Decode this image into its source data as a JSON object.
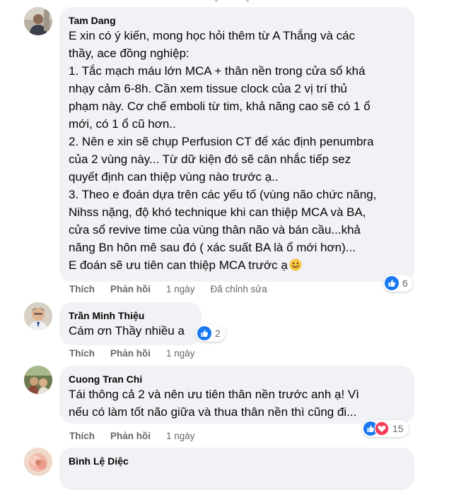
{
  "actions": {
    "like": "Thích",
    "reply": "Phản hồi"
  },
  "comments": [
    {
      "author": "Tam Dang",
      "lines": [
        "E xin có ý kiến, mong học hỏi thêm từ A Thắng và các",
        "thầy, ace đồng nghiệp:",
        "1. Tắc mạch máu lớn MCA + thân nền trong cửa sổ khá",
        "nhạy cảm 6-8h. Cần xem tissue clock của 2 vị trí thủ",
        "phạm này. Cơ chế emboli từ tim, khả năng cao sẽ có 1 ổ",
        "mới, có 1 ổ cũ hơn..",
        "2. Nên e xin sẽ chụp Perfusion CT để xác định penumbra",
        "của 2 vùng này... Từ dữ kiện đó sẽ cân nhắc tiếp sez",
        "quyết định can thiệp vùng nào trước ạ..",
        "3. Theo e đoán dựa trên các yếu tố (vùng não chức năng,",
        "Nihss nặng, độ khó technique khi can thiệp MCA và BA,",
        "cửa sổ revive time của vùng thân não và bán cầu...khả",
        "năng Bn hôn mê sau đó ( xác suất BA là ổ mới hơn)...",
        "E đoán sẽ ưu tiên can thiệp MCA trước ạ"
      ],
      "time": "1 ngày",
      "edited": "Đã chỉnh sửa",
      "reaction_count": "6"
    },
    {
      "author": "Trần Minh Thiệu",
      "lines": [
        "Cám ơn Thầy nhiều a"
      ],
      "time": "1 ngày",
      "reaction_count": "2"
    },
    {
      "author": "Cuong Tran Chi",
      "lines": [
        "Tái thông cả 2 và nên ưu tiên thân nền trước anh ạ! Vì",
        "nếu có làm tốt não giữa và thua thân nền thì cũng đi..."
      ],
      "time": "1 ngày",
      "reaction_count": "15"
    },
    {
      "author": "Bình Lệ Diệc",
      "lines": [],
      "time": "",
      "reaction_count": ""
    }
  ],
  "colors": {
    "like_blue": "#1877f2",
    "love_red": "#f33e58",
    "bubble": "#f0f2f5",
    "meta_gray": "#65676b"
  },
  "icons": [
    "like-reaction-icon",
    "love-reaction-icon",
    "smile-emoji-icon"
  ]
}
